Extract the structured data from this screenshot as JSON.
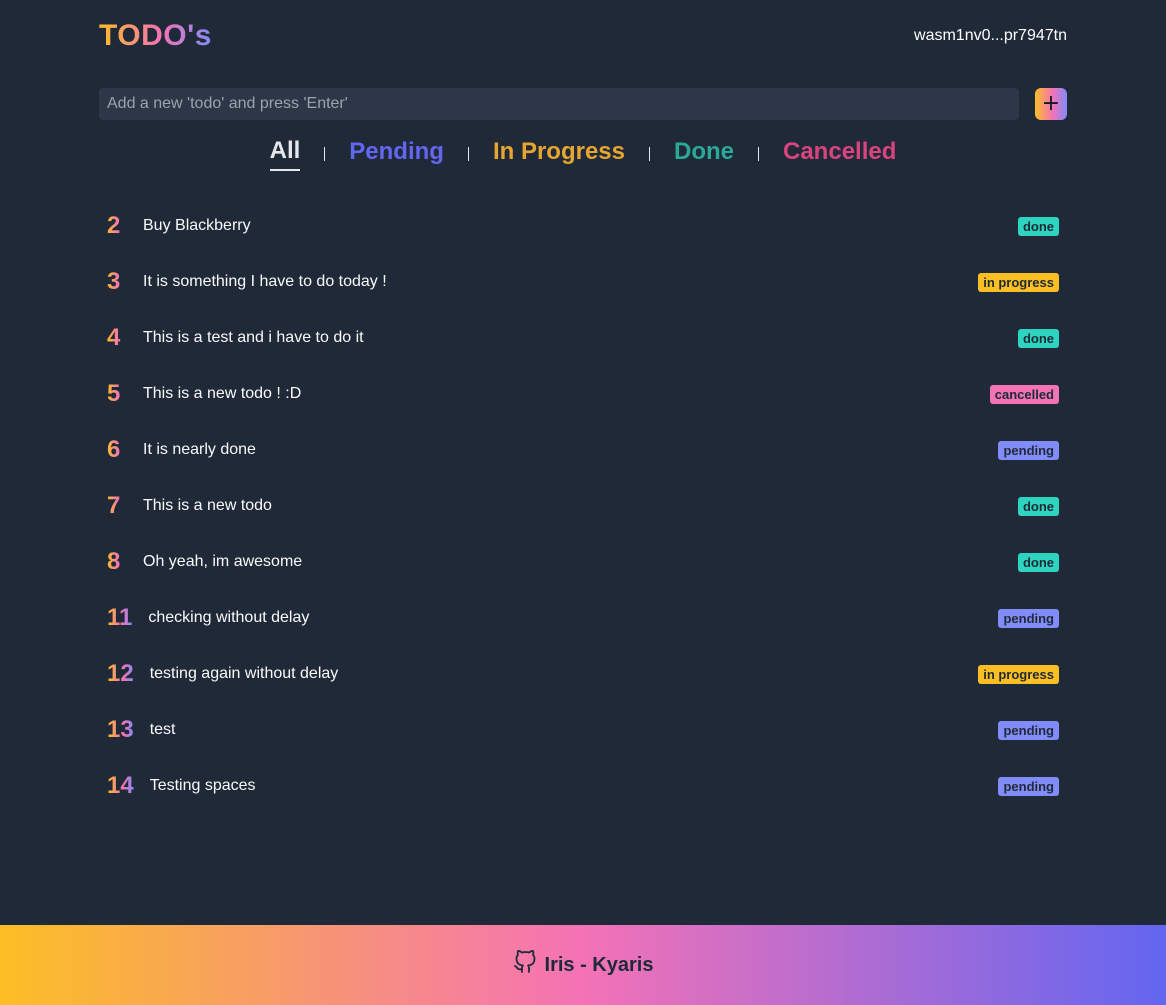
{
  "header": {
    "logo": "TODO's",
    "wallet": "wasm1nv0...pr7947tn"
  },
  "add": {
    "placeholder": "Add a new 'todo' and press 'Enter'",
    "button_label": "+"
  },
  "filters": [
    {
      "label": "All",
      "active": true
    },
    {
      "label": "Pending",
      "color": "#6366f1"
    },
    {
      "label": "In Progress",
      "color": "#e6a530"
    },
    {
      "label": "Done",
      "color": "#2aa89a"
    },
    {
      "label": "Cancelled",
      "color": "#d9447f"
    }
  ],
  "todos": [
    {
      "id": "2",
      "text": "Buy Blackberry",
      "status": "done"
    },
    {
      "id": "3",
      "text": "It is something I have to do today !",
      "status": "in progress"
    },
    {
      "id": "4",
      "text": "This is a test and i have to do it",
      "status": "done"
    },
    {
      "id": "5",
      "text": "This is a new todo ! :D",
      "status": "cancelled"
    },
    {
      "id": "6",
      "text": "It is nearly done",
      "status": "pending"
    },
    {
      "id": "7",
      "text": "This is a new todo",
      "status": "done"
    },
    {
      "id": "8",
      "text": "Oh yeah, im awesome",
      "status": "done"
    },
    {
      "id": "11",
      "text": "checking without delay",
      "status": "pending"
    },
    {
      "id": "12",
      "text": "testing again without delay",
      "status": "in progress"
    },
    {
      "id": "13",
      "text": "test",
      "status": "pending"
    },
    {
      "id": "14",
      "text": "Testing spaces",
      "status": "pending"
    }
  ],
  "status_colors": {
    "done": "#2dd4bf",
    "in progress": "#fbbf24",
    "cancelled": "#f472b6",
    "pending": "#818cf8"
  },
  "footer": {
    "icon": "github-icon",
    "label": "Iris - Kyaris"
  }
}
